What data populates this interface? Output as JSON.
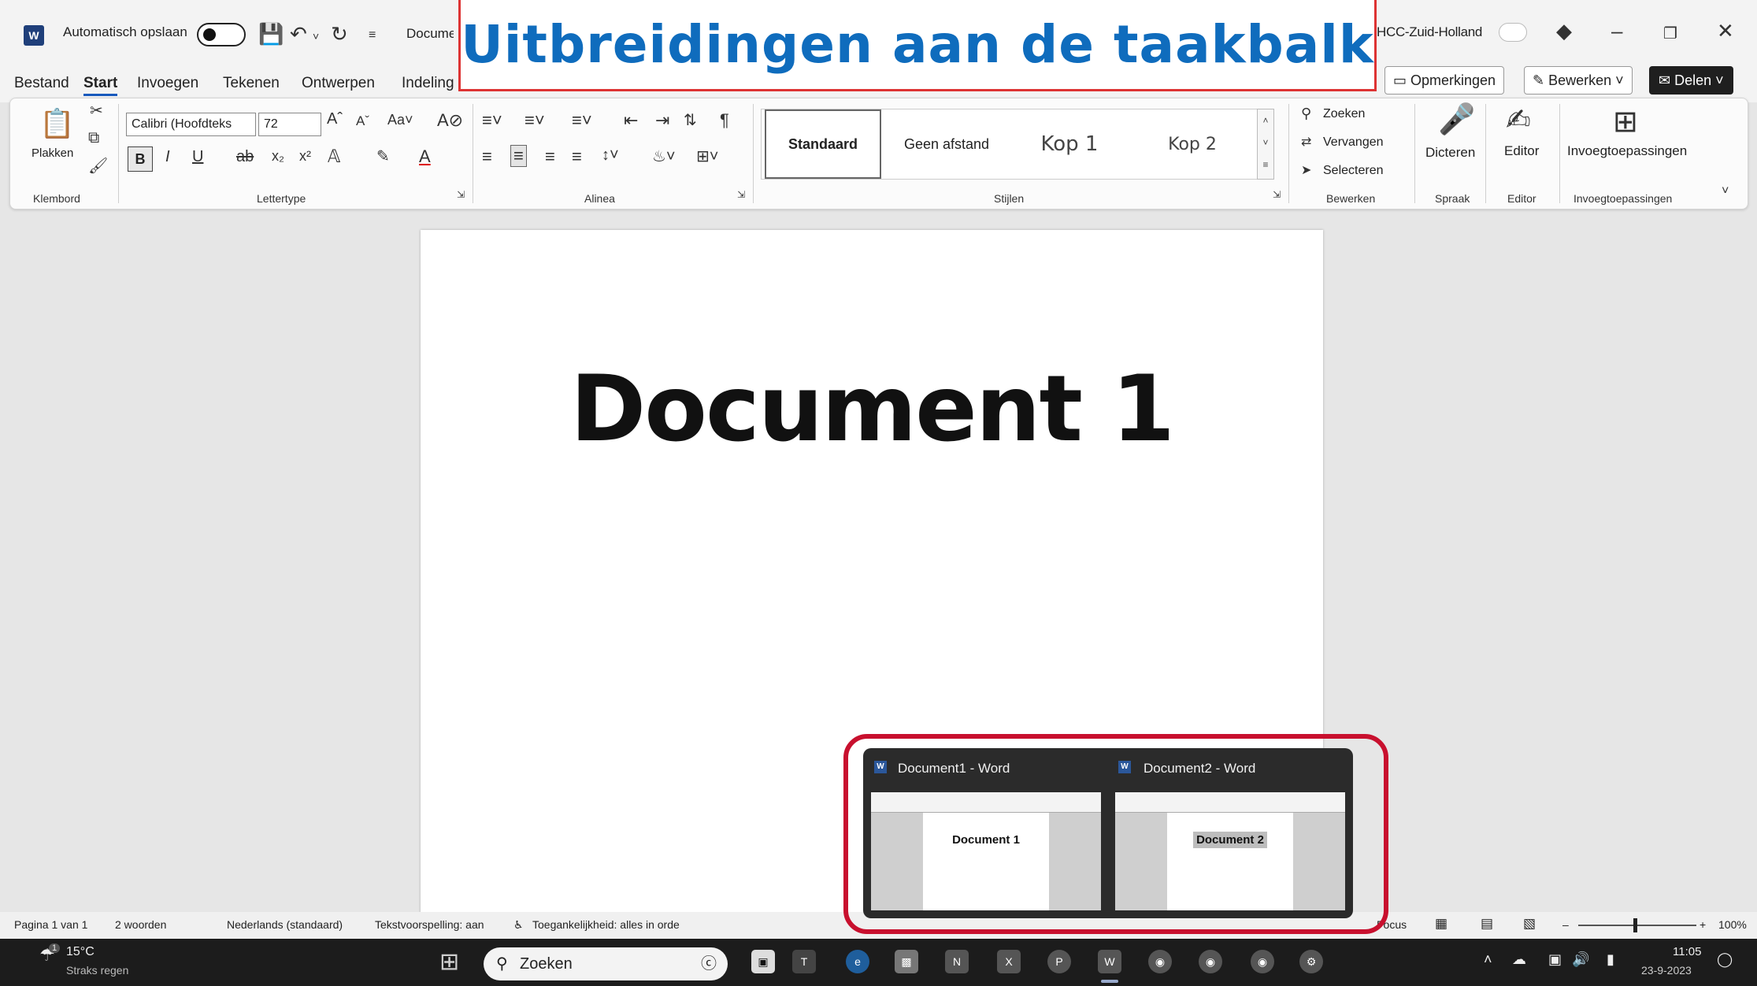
{
  "overlay": {
    "title": "Uitbreidingen aan de taakbalk"
  },
  "titlebar": {
    "autosave_label": "Automatisch opslaan",
    "doc_title": "Docume",
    "org_label": "HCC-Zuid-Holland",
    "icons": [
      "save-icon",
      "undo-icon",
      "redo-icon",
      "customize-icon",
      "diamond-icon",
      "minimize-icon",
      "restore-icon",
      "close-icon"
    ]
  },
  "menu": {
    "tabs": [
      "Bestand",
      "Start",
      "Invoegen",
      "Tekenen",
      "Ontwerpen",
      "Indeling"
    ],
    "active_tab": "Start",
    "comments_label": "Opmerkingen",
    "edit_label": "Bewerken",
    "share_label": "Delen"
  },
  "ribbon": {
    "paste_label": "Plakken",
    "font_name": "Calibri (Hoofdteks",
    "font_size": "72",
    "bold": "B",
    "styles": [
      "Standaard",
      "Geen afstand",
      "Kop 1",
      "Kop 2"
    ],
    "find_label": "Zoeken",
    "replace_label": "Vervangen",
    "select_label": "Selecteren",
    "dictate_label": "Dicteren",
    "editor_label": "Editor",
    "addins_label": "Invoegtoepassingen",
    "groups": [
      "Klembord",
      "Lettertype",
      "Alinea",
      "Stijlen",
      "Bewerken",
      "Spraak",
      "Editor",
      "Invoegtoepassingen"
    ]
  },
  "document": {
    "heading": "Document 1"
  },
  "statusbar": {
    "page": "Pagina 1 van 1",
    "words": "2 woorden",
    "language": "Nederlands (standaard)",
    "spelling": "Tekstvoorspelling: aan",
    "accessibility": "Toegankelijkheid: alles in orde",
    "focus": "Focus",
    "zoom": "100%"
  },
  "taskbar": {
    "weather_temp": "15°C",
    "weather_desc": "Straks regen",
    "weather_badge": "1",
    "search_label": "Zoeken",
    "time": "11:05",
    "date": "23-9-2023"
  },
  "preview": {
    "items": [
      {
        "title": "Document1 - Word",
        "doc_text": "Document 1"
      },
      {
        "title": "Document2 - Word",
        "doc_text": "Document 2"
      }
    ]
  },
  "colors": {
    "accent": "#0f6cbd",
    "highlight": "#c8102e",
    "taskbar": "#1c1c1c"
  }
}
